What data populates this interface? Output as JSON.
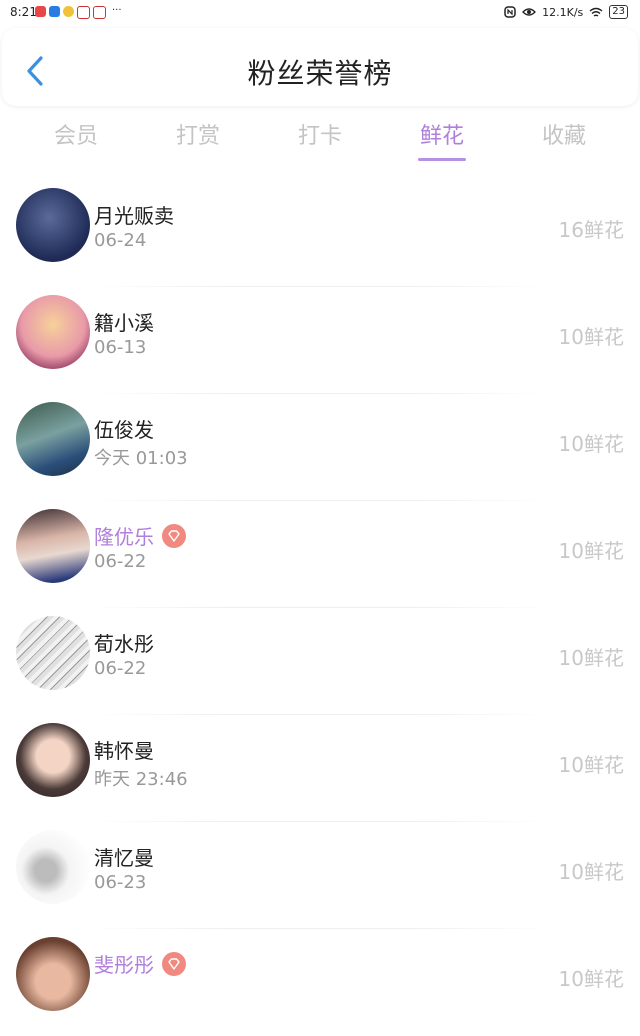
{
  "status_bar": {
    "time": "8:21",
    "more": "···",
    "network_speed": "12.1K/s",
    "battery": "23"
  },
  "header": {
    "title": "粉丝荣誉榜"
  },
  "tabs": [
    {
      "label": "会员"
    },
    {
      "label": "打赏"
    },
    {
      "label": "打卡"
    },
    {
      "label": "鲜花",
      "active": true
    },
    {
      "label": "收藏"
    }
  ],
  "list": [
    {
      "name": "月光贩卖",
      "date": "06-24",
      "amount": "16鲜花",
      "vip": false
    },
    {
      "name": "籍小溪",
      "date": "06-13",
      "amount": "10鲜花",
      "vip": false
    },
    {
      "name": "伍俊发",
      "date": "今天 01:03",
      "amount": "10鲜花",
      "vip": false
    },
    {
      "name": "隆优乐",
      "date": "06-22",
      "amount": "10鲜花",
      "vip": true
    },
    {
      "name": "荀水彤",
      "date": "06-22",
      "amount": "10鲜花",
      "vip": false
    },
    {
      "name": "韩怀曼",
      "date": "昨天 23:46",
      "amount": "10鲜花",
      "vip": false
    },
    {
      "name": "清忆曼",
      "date": "06-23",
      "amount": "10鲜花",
      "vip": false
    },
    {
      "name": "斐彤彤",
      "date": "",
      "amount": "10鲜花",
      "vip": true
    }
  ],
  "colors": {
    "accent": "#b07fdc",
    "vip_badge": "#f08a80",
    "back_arrow": "#3d8fe0"
  }
}
